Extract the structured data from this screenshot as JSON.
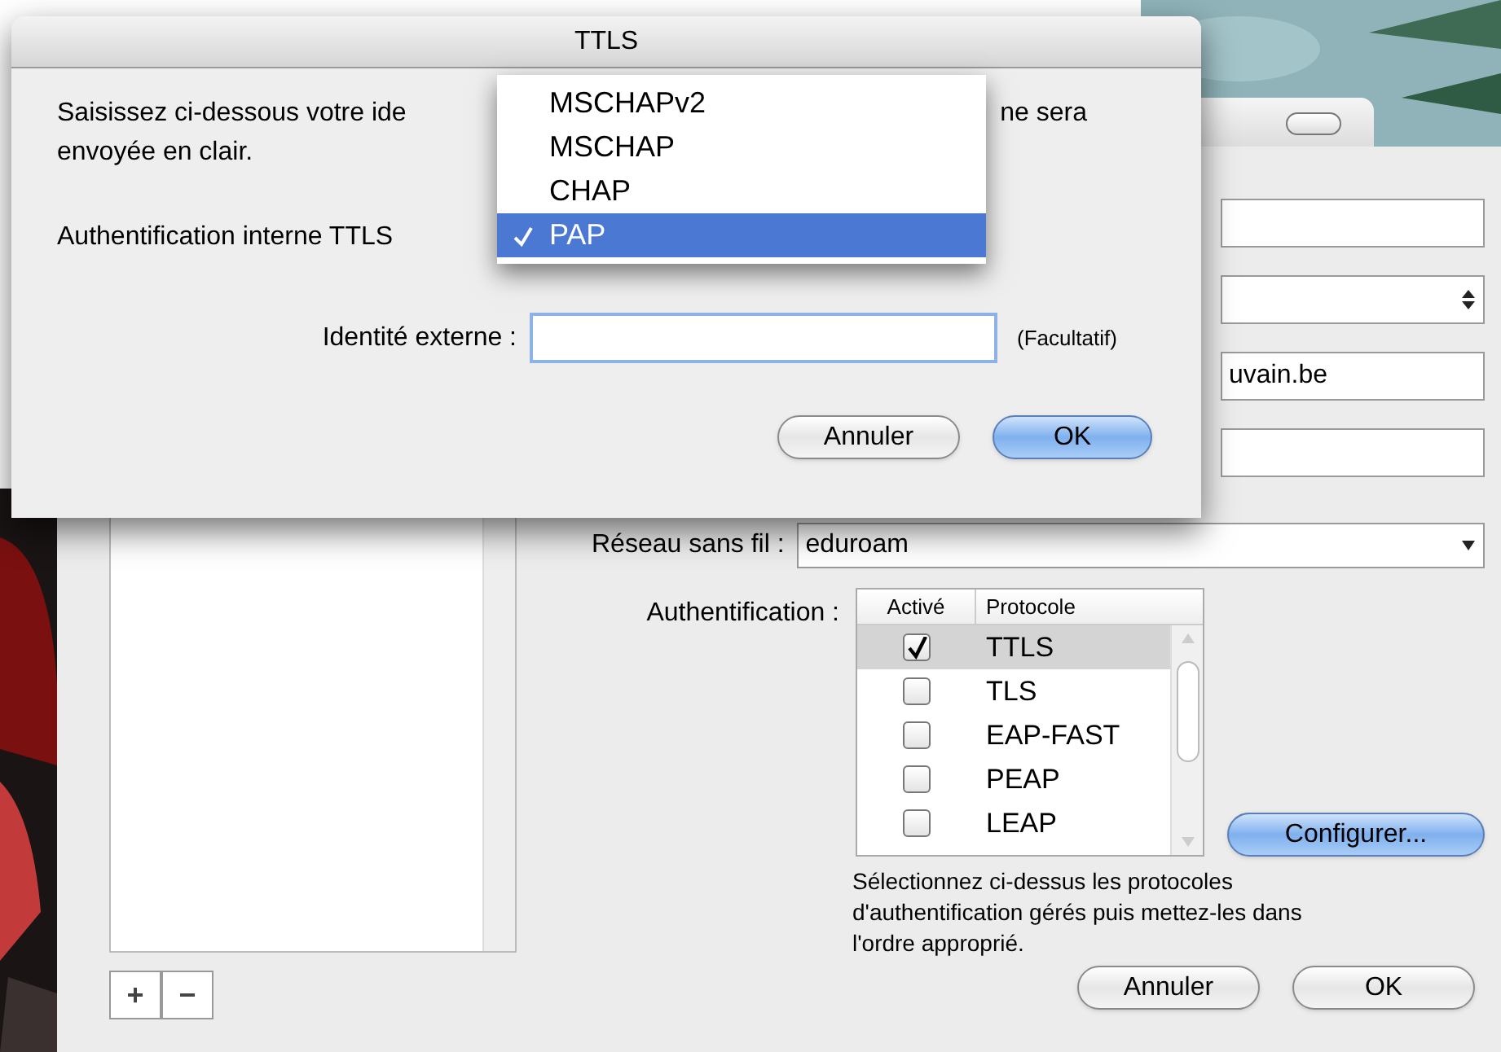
{
  "main_window": {
    "fields": [
      {
        "kind": "text"
      },
      {
        "kind": "stepper"
      },
      {
        "kind": "text",
        "value": "uvain.be"
      },
      {
        "kind": "text"
      }
    ],
    "network": {
      "label": "Réseau sans fil :",
      "value": "eduroam"
    },
    "authentication": {
      "label": "Authentification :",
      "columns": [
        "Activé",
        "Protocole"
      ],
      "protocols": [
        {
          "name": "TTLS",
          "checked": true,
          "selected": true
        },
        {
          "name": "TLS",
          "checked": false,
          "selected": false
        },
        {
          "name": "EAP-FAST",
          "checked": false,
          "selected": false
        },
        {
          "name": "PEAP",
          "checked": false,
          "selected": false
        },
        {
          "name": "LEAP",
          "checked": false,
          "selected": false
        }
      ],
      "configure_button": "Configurer...",
      "help": "Sélectionnez ci-dessus les protocoles d'authentification gérés puis mettez-les dans l'ordre approprié."
    },
    "list_buttons": [
      "+",
      "−"
    ],
    "buttons": [
      {
        "label": "Annuler",
        "default": false
      },
      {
        "label": "OK",
        "default": false
      }
    ]
  },
  "dialog": {
    "title": "TTLS",
    "intro_left": "Saisissez ci-dessous votre ide",
    "intro_right": "ne sera",
    "intro_line2": "envoyée en clair.",
    "inner_auth_label": "Authentification interne TTLS",
    "identity_label": "Identité externe :",
    "optional_note": "(Facultatif)",
    "buttons": [
      {
        "label": "Annuler",
        "default": false
      },
      {
        "label": "OK",
        "default": true
      }
    ]
  },
  "menu": {
    "items": [
      {
        "label": "MSCHAPv2",
        "selected": false
      },
      {
        "label": "MSCHAP",
        "selected": false
      },
      {
        "label": "CHAP",
        "selected": false
      },
      {
        "label": "PAP",
        "selected": true
      }
    ]
  }
}
